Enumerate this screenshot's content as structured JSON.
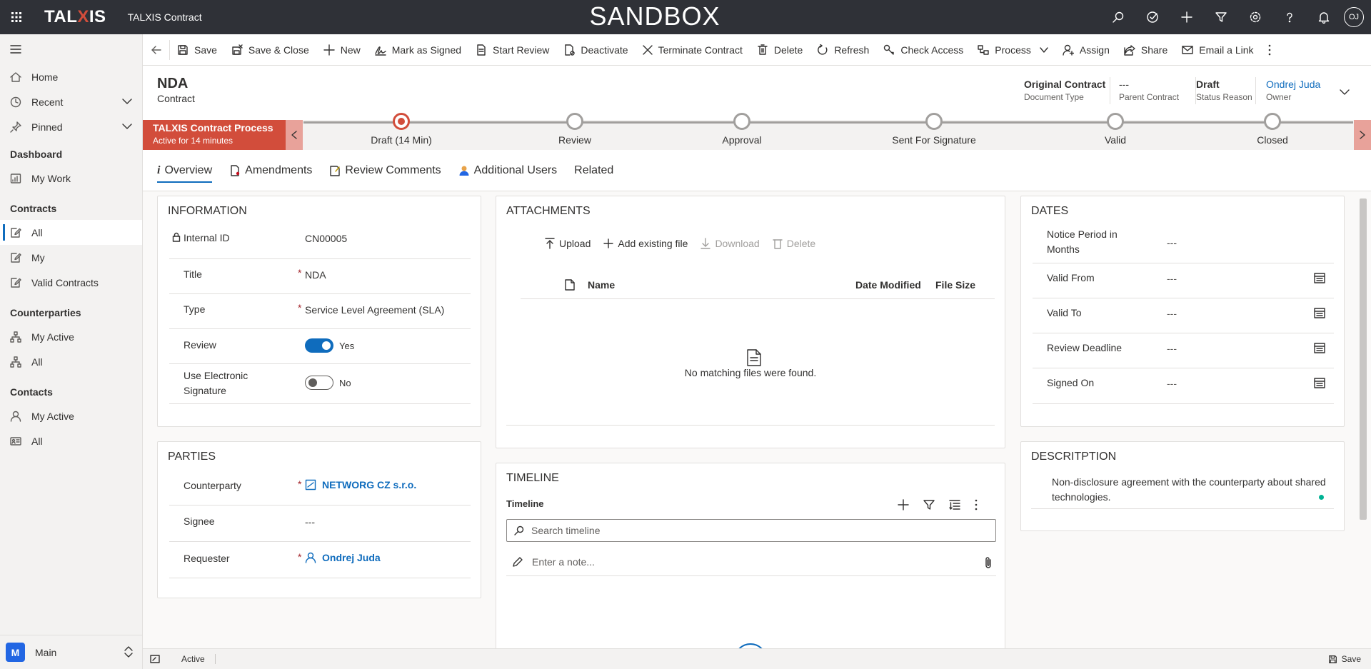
{
  "app": {
    "logo": "TALXIS",
    "name": "TALXIS Contract",
    "environment": "SANDBOX",
    "user_initials": "OJ"
  },
  "nav": {
    "top_items": [
      {
        "label": "Home"
      },
      {
        "label": "Recent"
      },
      {
        "label": "Pinned"
      }
    ],
    "groups": {
      "dashboard": "Dashboard",
      "my_work": "My Work",
      "contracts": "Contracts",
      "contracts_all": "All",
      "contracts_my": "My",
      "contracts_valid": "Valid Contracts",
      "counterparties": "Counterparties",
      "cp_my_active": "My Active",
      "cp_all": "All",
      "contacts": "Contacts",
      "ct_my_active": "My Active",
      "ct_all": "All"
    },
    "area_badge": "M",
    "area": "Main"
  },
  "commands": {
    "save": "Save",
    "save_close": "Save & Close",
    "new": "New",
    "mark_signed": "Mark as Signed",
    "start_review": "Start Review",
    "deactivate": "Deactivate",
    "terminate": "Terminate Contract",
    "delete": "Delete",
    "refresh": "Refresh",
    "check_access": "Check Access",
    "process": "Process",
    "assign": "Assign",
    "share": "Share",
    "email_link": "Email a Link"
  },
  "header": {
    "title": "NDA",
    "entity": "Contract",
    "fields": [
      {
        "value": "Original Contract",
        "label": "Document Type"
      },
      {
        "value": "---",
        "label": "Parent Contract"
      },
      {
        "value": "Draft",
        "label": "Status Reason"
      },
      {
        "value": "Ondrej Juda",
        "label": "Owner"
      }
    ]
  },
  "bpf": {
    "name": "TALXIS Contract Process",
    "active_for": "Active for 14 minutes",
    "stages": [
      "Draft  (14 Min)",
      "Review",
      "Approval",
      "Sent For Signature",
      "Valid",
      "Closed"
    ]
  },
  "tabs": [
    "Overview",
    "Amendments",
    "Review Comments",
    "Additional Users",
    "Related"
  ],
  "information": {
    "title": "INFORMATION",
    "internal_id_label": "Internal ID",
    "internal_id": "CN00005",
    "title_label": "Title",
    "title_value": "NDA",
    "type_label": "Type",
    "type_value": "Service Level Agreement (SLA)",
    "review_label": "Review",
    "review_value": "Yes",
    "esign_label_1": "Use Electronic",
    "esign_label_2": "Signature",
    "esign_value": "No",
    "required_mark": "*"
  },
  "parties": {
    "title": "PARTIES",
    "counterparty_label": "Counterparty",
    "counterparty": "NETWORG CZ s.r.o.",
    "signee_label": "Signee",
    "signee": "---",
    "requester_label": "Requester",
    "requester": "Ondrej Juda"
  },
  "attachments": {
    "title": "ATTACHMENTS",
    "upload": "Upload",
    "add_existing": "Add existing file",
    "download": "Download",
    "delete": "Delete",
    "col_name": "Name",
    "col_modified": "Date Modified",
    "col_size": "File Size",
    "empty": "No matching files were found."
  },
  "timeline": {
    "section_title": "TIMELINE",
    "label": "Timeline",
    "search_placeholder": "Search timeline",
    "note_placeholder": "Enter a note..."
  },
  "dates": {
    "title": "DATES",
    "notice_label_1": "Notice Period in",
    "notice_label_2": "Months",
    "notice_value": "---",
    "valid_from_label": "Valid From",
    "valid_from": "---",
    "valid_to_label": "Valid To",
    "valid_to": "---",
    "review_deadline_label": "Review Deadline",
    "review_deadline": "---",
    "signed_on_label": "Signed On",
    "signed_on": "---"
  },
  "description": {
    "title": "DESCRITPTION",
    "text_1": "Non-disclosure agreement with the counterparty about shared",
    "text_2": "technologies."
  },
  "status_bar": {
    "status": "Active",
    "save": "Save"
  },
  "colors": {
    "brand_red": "#d24d3b",
    "accent_blue": "#0f6cbd",
    "topbar": "#2f3137"
  }
}
